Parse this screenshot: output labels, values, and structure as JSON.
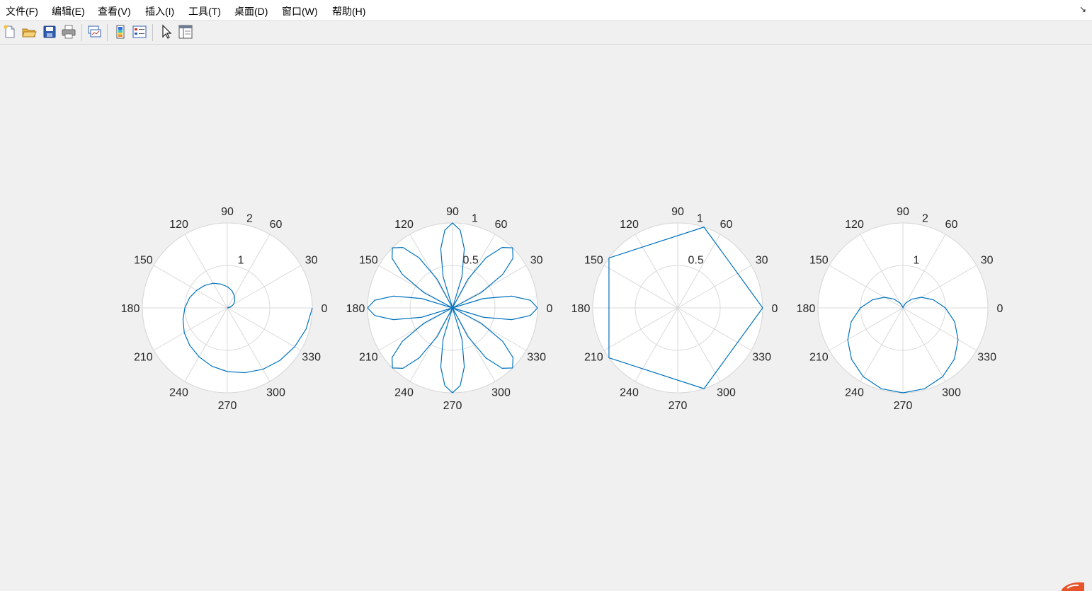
{
  "menubar": {
    "items": [
      "文件(F)",
      "编辑(E)",
      "查看(V)",
      "插入(I)",
      "工具(T)",
      "桌面(D)",
      "窗口(W)",
      "帮助(H)"
    ],
    "dock_icon": "dock-arrow-icon"
  },
  "toolbar": {
    "buttons": [
      "new-figure-icon",
      "open-file-icon",
      "save-icon",
      "print-icon",
      "link-plot-icon",
      "insert-colorbar-icon",
      "insert-legend-icon",
      "pointer-icon",
      "property-editor-icon"
    ]
  },
  "colors": {
    "line": "#0072bd",
    "grid": "#d9d9d9",
    "axes_bg": "#ffffff",
    "figure_bg": "#f0f0f0"
  },
  "chart_data": [
    {
      "type": "line",
      "projection": "polar",
      "curve": "archimedean-spiral",
      "rmax": 2,
      "r_ticks": [
        "1",
        "2"
      ],
      "theta_ticks": [
        "0",
        "30",
        "60",
        "90",
        "120",
        "150",
        "180",
        "210",
        "240",
        "270",
        "300",
        "330"
      ],
      "points": [
        [
          0,
          0
        ],
        [
          15,
          0.08
        ],
        [
          30,
          0.17
        ],
        [
          45,
          0.25
        ],
        [
          60,
          0.33
        ],
        [
          75,
          0.42
        ],
        [
          90,
          0.5
        ],
        [
          105,
          0.58
        ],
        [
          120,
          0.67
        ],
        [
          135,
          0.75
        ],
        [
          150,
          0.83
        ],
        [
          165,
          0.92
        ],
        [
          180,
          1.0
        ],
        [
          195,
          1.08
        ],
        [
          210,
          1.17
        ],
        [
          225,
          1.25
        ],
        [
          240,
          1.33
        ],
        [
          255,
          1.42
        ],
        [
          270,
          1.5
        ],
        [
          285,
          1.58
        ],
        [
          300,
          1.67
        ],
        [
          315,
          1.75
        ],
        [
          330,
          1.83
        ],
        [
          345,
          1.92
        ],
        [
          360,
          2.0
        ]
      ]
    },
    {
      "type": "line",
      "projection": "polar",
      "curve": "rose |cos(4θ)|",
      "rmax": 1,
      "r_ticks": [
        "0.5",
        "1"
      ],
      "theta_ticks": [
        "0",
        "30",
        "60",
        "90",
        "120",
        "150",
        "180",
        "210",
        "240",
        "270",
        "300",
        "330"
      ],
      "points": [
        [
          0,
          1
        ],
        [
          5.625,
          0.92
        ],
        [
          11.25,
          0.71
        ],
        [
          16.875,
          0.38
        ],
        [
          22.5,
          0
        ],
        [
          28.125,
          0.38
        ],
        [
          33.75,
          0.71
        ],
        [
          39.375,
          0.92
        ],
        [
          45,
          1
        ],
        [
          50.625,
          0.92
        ],
        [
          56.25,
          0.71
        ],
        [
          61.875,
          0.38
        ],
        [
          67.5,
          0
        ],
        [
          73.125,
          0.38
        ],
        [
          78.75,
          0.71
        ],
        [
          84.375,
          0.92
        ],
        [
          90,
          1
        ],
        [
          95.625,
          0.92
        ],
        [
          101.25,
          0.71
        ],
        [
          106.875,
          0.38
        ],
        [
          112.5,
          0
        ],
        [
          118.125,
          0.38
        ],
        [
          123.75,
          0.71
        ],
        [
          129.375,
          0.92
        ],
        [
          135,
          1
        ],
        [
          140.625,
          0.92
        ],
        [
          146.25,
          0.71
        ],
        [
          151.875,
          0.38
        ],
        [
          157.5,
          0
        ],
        [
          163.125,
          0.38
        ],
        [
          168.75,
          0.71
        ],
        [
          174.375,
          0.92
        ],
        [
          180,
          1
        ],
        [
          185.625,
          0.92
        ],
        [
          191.25,
          0.71
        ],
        [
          196.875,
          0.38
        ],
        [
          202.5,
          0
        ],
        [
          208.125,
          0.38
        ],
        [
          213.75,
          0.71
        ],
        [
          219.375,
          0.92
        ],
        [
          225,
          1
        ],
        [
          230.625,
          0.92
        ],
        [
          236.25,
          0.71
        ],
        [
          241.875,
          0.38
        ],
        [
          247.5,
          0
        ],
        [
          253.125,
          0.38
        ],
        [
          258.75,
          0.71
        ],
        [
          264.375,
          0.92
        ],
        [
          270,
          1
        ],
        [
          275.625,
          0.92
        ],
        [
          281.25,
          0.71
        ],
        [
          286.875,
          0.38
        ],
        [
          292.5,
          0
        ],
        [
          298.125,
          0.38
        ],
        [
          303.75,
          0.71
        ],
        [
          309.375,
          0.92
        ],
        [
          315,
          1
        ],
        [
          320.625,
          0.92
        ],
        [
          326.25,
          0.71
        ],
        [
          331.875,
          0.38
        ],
        [
          337.5,
          0
        ],
        [
          343.125,
          0.38
        ],
        [
          348.75,
          0.71
        ],
        [
          354.375,
          0.92
        ],
        [
          360,
          1
        ]
      ]
    },
    {
      "type": "line",
      "projection": "polar",
      "curve": "pentagon",
      "rmax": 1,
      "r_ticks": [
        "0.5",
        "1"
      ],
      "theta_ticks": [
        "0",
        "30",
        "60",
        "90",
        "120",
        "150",
        "180",
        "210",
        "240",
        "270",
        "300",
        "330"
      ],
      "points": [
        [
          0,
          1
        ],
        [
          72,
          1
        ],
        [
          144,
          1
        ],
        [
          216,
          1
        ],
        [
          288,
          1
        ],
        [
          360,
          1
        ]
      ]
    },
    {
      "type": "line",
      "projection": "polar",
      "curve": "cardioid r = 1 - sin(θ)",
      "rmax": 2,
      "r_ticks": [
        "1",
        "2"
      ],
      "theta_ticks": [
        "0",
        "30",
        "60",
        "90",
        "120",
        "150",
        "180",
        "210",
        "240",
        "270",
        "300",
        "330"
      ],
      "points": [
        [
          0,
          1.0
        ],
        [
          15,
          0.74
        ],
        [
          30,
          0.5
        ],
        [
          45,
          0.29
        ],
        [
          60,
          0.13
        ],
        [
          75,
          0.03
        ],
        [
          90,
          0
        ],
        [
          105,
          0.03
        ],
        [
          120,
          0.13
        ],
        [
          135,
          0.29
        ],
        [
          150,
          0.5
        ],
        [
          165,
          0.74
        ],
        [
          180,
          1.0
        ],
        [
          195,
          1.26
        ],
        [
          210,
          1.5
        ],
        [
          225,
          1.71
        ],
        [
          240,
          1.87
        ],
        [
          255,
          1.97
        ],
        [
          270,
          2.0
        ],
        [
          285,
          1.97
        ],
        [
          300,
          1.87
        ],
        [
          315,
          1.71
        ],
        [
          330,
          1.5
        ],
        [
          345,
          1.26
        ],
        [
          360,
          1.0
        ]
      ]
    }
  ]
}
